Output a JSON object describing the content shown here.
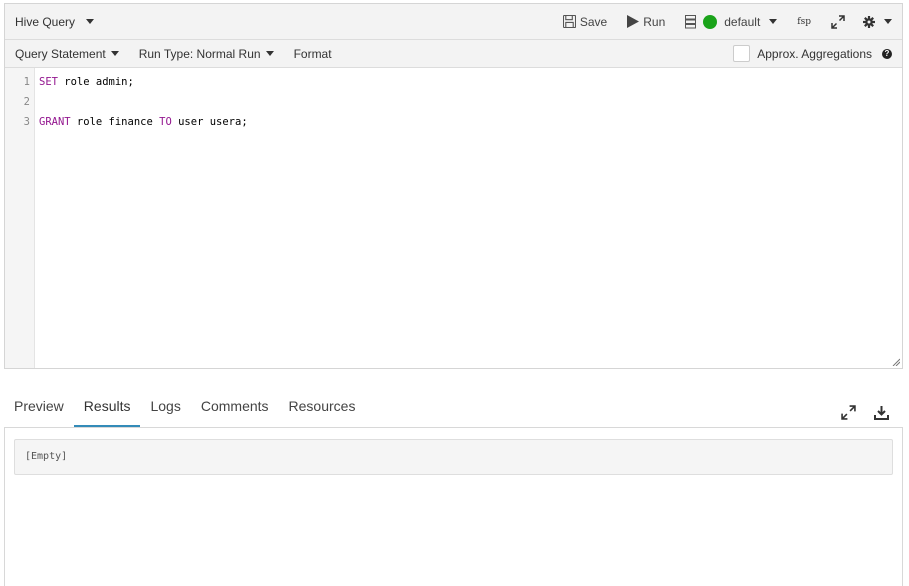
{
  "editor": {
    "query_type_label": "Hive Query",
    "toolbar": {
      "save_label": "Save",
      "run_label": "Run",
      "database_label": "default",
      "format_icon_label": "fsp",
      "status_color": "#1aa31a"
    },
    "subbar": {
      "query_statement_label": "Query Statement",
      "run_type_label": "Run Type: Normal Run",
      "format_label": "Format",
      "approx_label": "Approx. Aggregations",
      "help_glyph": "?"
    },
    "lines": [
      {
        "number": "1",
        "keyword": "SET",
        "rest": " role admin;",
        "tail_keyword": "",
        "tail": ""
      },
      {
        "number": "2",
        "keyword": "",
        "rest": "",
        "tail_keyword": "",
        "tail": ""
      },
      {
        "number": "3",
        "keyword": "GRANT",
        "rest": " role finance ",
        "tail_keyword": "TO",
        "tail": " user usera;"
      }
    ]
  },
  "tabs": [
    {
      "label": "Preview"
    },
    {
      "label": "Results",
      "active": true
    },
    {
      "label": "Logs"
    },
    {
      "label": "Comments"
    },
    {
      "label": "Resources"
    }
  ],
  "results": {
    "empty_label": "[Empty]"
  },
  "colors": {
    "keyword": "#93168f",
    "tab_active_underline": "#338bb8"
  }
}
